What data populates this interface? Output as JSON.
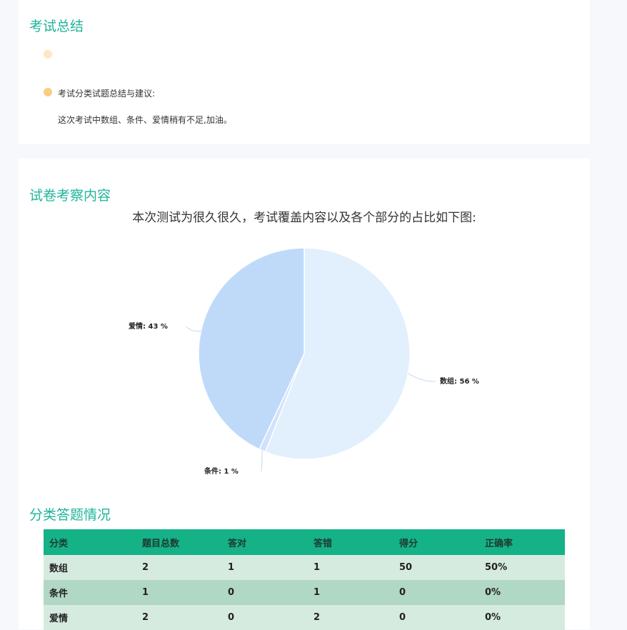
{
  "summary": {
    "title": "考试总结",
    "bullet_1_text": "",
    "bullet_2_label": "考试分类试题总结与建议:",
    "advice": "这次考试中数组、条件、爱情稍有不足,加油。"
  },
  "content": {
    "title": "试卷考察内容",
    "subtitle": "本次测试为很久很久，考试覆盖内容以及各个部分的占比如下图:"
  },
  "chart_data": {
    "type": "pie",
    "title": "",
    "slices": [
      {
        "label": "数组",
        "value": 56,
        "display": "数组: 56 %",
        "color": "#e2effd"
      },
      {
        "label": "条件",
        "value": 1,
        "display": "条件: 1 %",
        "color": "#d0e3fb"
      },
      {
        "label": "爱情",
        "value": 43,
        "display": "爱情: 43 %",
        "color": "#bfdaf9"
      }
    ]
  },
  "category_table": {
    "title": "分类答题情况",
    "headers": [
      "分类",
      "题目总数",
      "答对",
      "答错",
      "得分",
      "正确率"
    ],
    "rows": [
      [
        "数组",
        "2",
        "1",
        "1",
        "50",
        "50%"
      ],
      [
        "条件",
        "1",
        "0",
        "1",
        "0",
        "0%"
      ],
      [
        "爱情",
        "2",
        "0",
        "2",
        "0",
        "0%"
      ]
    ],
    "header_color": "#14b286"
  },
  "colors": {
    "accent": "#1fb59a",
    "bullet_light": "#fde7c4",
    "bullet": "#f9cd86"
  }
}
